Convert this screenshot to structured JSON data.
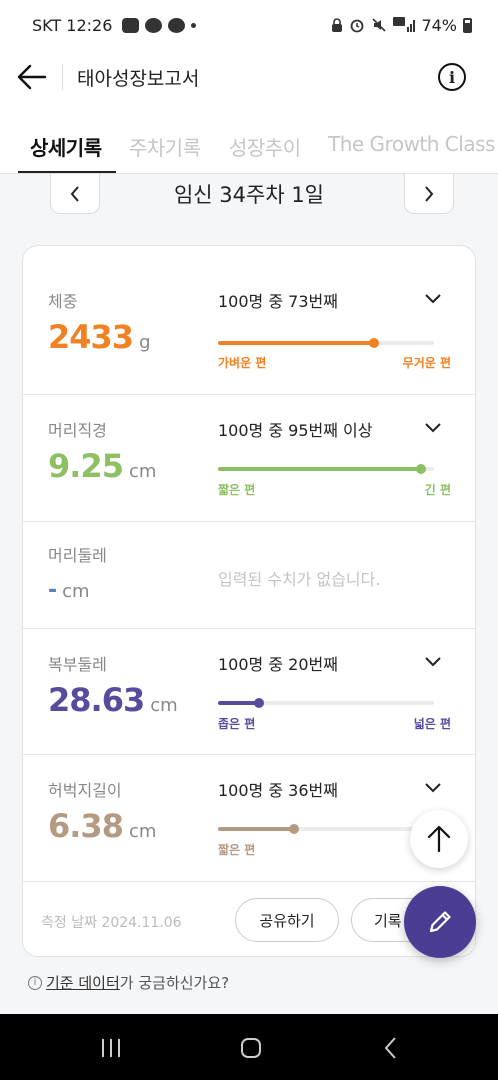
{
  "status_bar": {
    "time": "SKT 12:26",
    "battery": "74%"
  },
  "header": {
    "title": "태아성장보고서"
  },
  "tabs": [
    {
      "label": "상세기록",
      "active": true
    },
    {
      "label": "주차기록",
      "active": false
    },
    {
      "label": "성장추이",
      "active": false
    },
    {
      "label": "The Growth Class",
      "active": false
    }
  ],
  "week": {
    "label": "임신 34주차 1일"
  },
  "metrics": [
    {
      "name": "체중",
      "value": "2433",
      "unit": "g",
      "rank": "100명 중 73번째",
      "left_label": "가벼운 편",
      "right_label": "무거운 편",
      "percentile": 0.72,
      "color": "#f08224"
    },
    {
      "name": "머리직경",
      "value": "9.25",
      "unit": "cm",
      "rank": "100명 중 95번째 이상",
      "left_label": "짧은 편",
      "right_label": "긴 편",
      "percentile": 0.94,
      "color": "#8cc063"
    },
    {
      "name": "머리둘레",
      "value": "-",
      "unit": "cm",
      "no_data": "입력된 수치가 없습니다.",
      "color": "#5c7fc4"
    },
    {
      "name": "복부둘레",
      "value": "28.63",
      "unit": "cm",
      "rank": "100명 중 20번째",
      "left_label": "좁은 편",
      "right_label": "넓은 편",
      "percentile": 0.19,
      "color": "#5a4a9e"
    },
    {
      "name": "허벅지길이",
      "value": "6.38",
      "unit": "cm",
      "rank": "100명 중 36번째",
      "left_label": "짧은 편",
      "right_label": "",
      "percentile": 0.35,
      "color": "#b49a82"
    }
  ],
  "footer": {
    "date": "측정 날짜 2024.11.06",
    "share_label": "공유하기",
    "record_label": "기록"
  },
  "help": {
    "link_text": "기준 데이터",
    "rest_text": "가 궁금하신가요?"
  }
}
